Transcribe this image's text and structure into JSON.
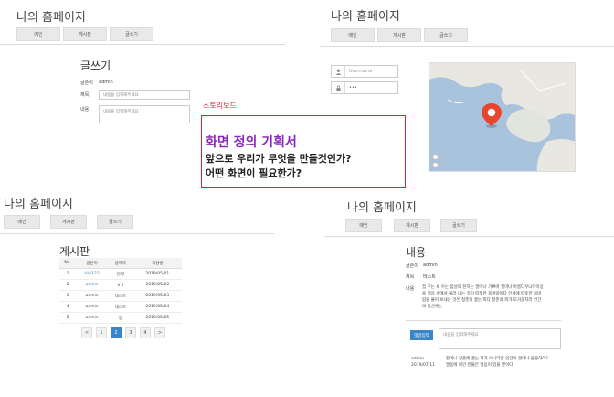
{
  "site": {
    "title": "나의 홈페이지"
  },
  "nav": {
    "main": "메인",
    "board": "게시판",
    "write": "글쓰기"
  },
  "write_page": {
    "heading": "글쓰기",
    "author_label": "글쓴이",
    "author_value": "admin",
    "title_label": "제목",
    "title_placeholder": "내용을 입력해주세요",
    "content_label": "내용",
    "content_placeholder": "내용을 입력해주세요"
  },
  "login": {
    "username_placeholder": "Username",
    "password_value": "•••"
  },
  "storyboard": {
    "label": "스토리보드",
    "title": "화면 정의 기획서",
    "line1": "앞으로 우리가 무엇을 만들것인가?",
    "line2": "어떤 화면이 필요한가?"
  },
  "board_page": {
    "heading": "게시판",
    "columns": [
      "No.",
      "글쓴이",
      "글제목",
      "작성일"
    ],
    "rows": [
      [
        "1",
        "kiki123",
        "안녕",
        "2019/05/01"
      ],
      [
        "2",
        "admin",
        "ㅎㅎ",
        "2019/05/02"
      ],
      [
        "3",
        "admin",
        "테스트",
        "2019/05/03"
      ],
      [
        "4",
        "admin",
        "테스트",
        "2019/05/04"
      ],
      [
        "5",
        "admin",
        "앙",
        "2019/05/05"
      ]
    ],
    "pagination": [
      "<",
      "1",
      "2",
      "3",
      "4",
      ">"
    ]
  },
  "detail_page": {
    "heading": "내용",
    "author_label": "글쓴이",
    "author_value": "admin",
    "title_label": "제목",
    "title_value": "테스트",
    "content_label": "내용",
    "content_line1": "꿈 꾸는 새 우는 봄날의 천지는 얼마나 기쁘며 얼마나 아름다우냐? 이상",
    "content_line2": "을 얼음 속에서 불러 내는 것이 따뜻한 봄바람이다 인생에 따뜻한 봄바",
    "content_line3": "람을 불어 보내는 것은 청춘의 끓는 피다 청춘의 피가 뜨거운지라 인간",
    "content_line4": "의 동산에는",
    "comment_button": "댓글입력",
    "comment_placeholder": "내용을 입력해주세요",
    "comment_author": "admin",
    "comment_date": "2019/07/11",
    "comment_line1": "할머니 청춘에 끓는 피가 아니더면 인간이 얼마나 쓸쓸하랴?",
    "comment_line2": "얼음에 싸인 만물은 얼음이 있을 뿐이다"
  },
  "colors": {
    "accent": "#3a86c8",
    "storyboard_border": "#d0263a",
    "storyboard_title": "#8a2ab8",
    "map_water": "#aac3dc",
    "pin": "#e8452f"
  }
}
